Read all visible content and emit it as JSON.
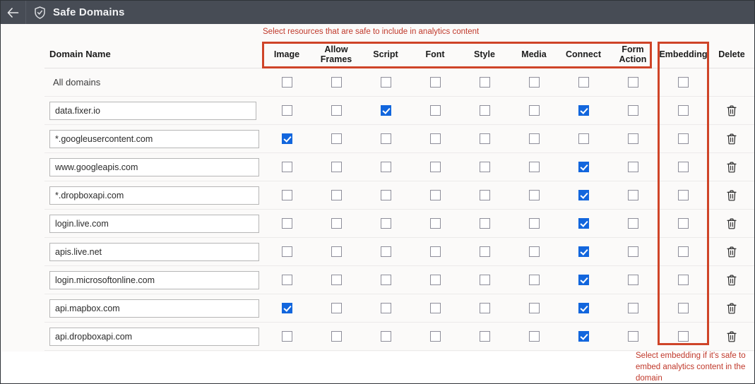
{
  "appbar": {
    "back_icon": "arrow-left-icon",
    "shield_icon": "shield-check-icon",
    "title": "Safe Domains"
  },
  "annotations": {
    "top": "Select resources that are safe to include in analytics content",
    "bottom": "Select embedding if it's safe to embed analytics content in the domain",
    "highlight_color": "#cf4428"
  },
  "table": {
    "columns": [
      {
        "key": "domain",
        "label": "Domain Name"
      },
      {
        "key": "image",
        "label": "Image"
      },
      {
        "key": "allow_frames",
        "label": "Allow\nFrames"
      },
      {
        "key": "script",
        "label": "Script"
      },
      {
        "key": "font",
        "label": "Font"
      },
      {
        "key": "style",
        "label": "Style"
      },
      {
        "key": "media",
        "label": "Media"
      },
      {
        "key": "connect",
        "label": "Connect"
      },
      {
        "key": "form_action",
        "label": "Form\nAction"
      },
      {
        "key": "embedding",
        "label": "Embedding"
      },
      {
        "key": "delete",
        "label": "Delete"
      }
    ],
    "all_domains_label": "All domains",
    "delete_icon": "trash-icon",
    "checkbox_checked_color": "#1266dd",
    "rows": [
      {
        "domain": "All domains",
        "is_editable": false,
        "has_delete": false,
        "image": false,
        "allow_frames": false,
        "script": false,
        "font": false,
        "style": false,
        "media": false,
        "connect": false,
        "form_action": false,
        "embedding": false
      },
      {
        "domain": "data.fixer.io",
        "is_editable": true,
        "has_delete": true,
        "image": false,
        "allow_frames": false,
        "script": true,
        "font": false,
        "style": false,
        "media": false,
        "connect": true,
        "form_action": false,
        "embedding": false
      },
      {
        "domain": "*.googleusercontent.com",
        "is_editable": true,
        "has_delete": true,
        "image": true,
        "allow_frames": false,
        "script": false,
        "font": false,
        "style": false,
        "media": false,
        "connect": false,
        "form_action": false,
        "embedding": false
      },
      {
        "domain": "www.googleapis.com",
        "is_editable": true,
        "has_delete": true,
        "image": false,
        "allow_frames": false,
        "script": false,
        "font": false,
        "style": false,
        "media": false,
        "connect": true,
        "form_action": false,
        "embedding": false
      },
      {
        "domain": "*.dropboxapi.com",
        "is_editable": true,
        "has_delete": true,
        "image": false,
        "allow_frames": false,
        "script": false,
        "font": false,
        "style": false,
        "media": false,
        "connect": true,
        "form_action": false,
        "embedding": false
      },
      {
        "domain": "login.live.com",
        "is_editable": true,
        "has_delete": true,
        "image": false,
        "allow_frames": false,
        "script": false,
        "font": false,
        "style": false,
        "media": false,
        "connect": true,
        "form_action": false,
        "embedding": false
      },
      {
        "domain": "apis.live.net",
        "is_editable": true,
        "has_delete": true,
        "image": false,
        "allow_frames": false,
        "script": false,
        "font": false,
        "style": false,
        "media": false,
        "connect": true,
        "form_action": false,
        "embedding": false
      },
      {
        "domain": "login.microsoftonline.com",
        "is_editable": true,
        "has_delete": true,
        "image": false,
        "allow_frames": false,
        "script": false,
        "font": false,
        "style": false,
        "media": false,
        "connect": true,
        "form_action": false,
        "embedding": false
      },
      {
        "domain": "api.mapbox.com",
        "is_editable": true,
        "has_delete": true,
        "image": true,
        "allow_frames": false,
        "script": false,
        "font": false,
        "style": false,
        "media": false,
        "connect": true,
        "form_action": false,
        "embedding": false
      },
      {
        "domain": "api.dropboxapi.com",
        "is_editable": true,
        "has_delete": true,
        "image": false,
        "allow_frames": false,
        "script": false,
        "font": false,
        "style": false,
        "media": false,
        "connect": true,
        "form_action": false,
        "embedding": false
      }
    ]
  }
}
